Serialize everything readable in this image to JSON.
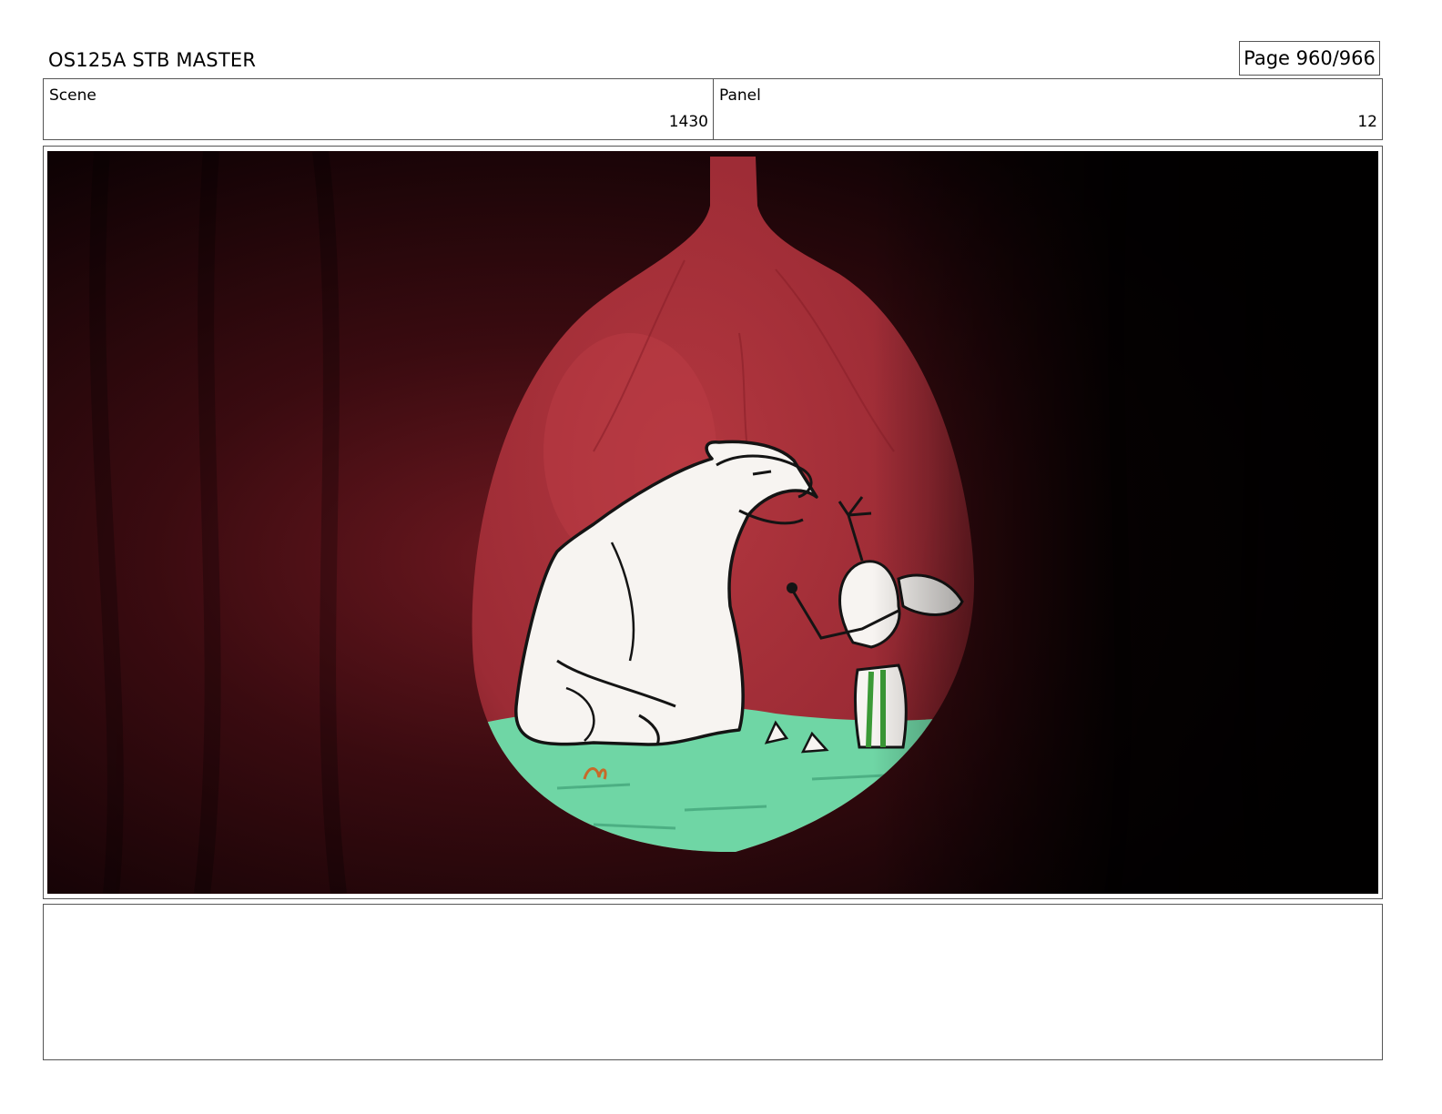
{
  "header": {
    "title": "OS125A STB MASTER",
    "page": "Page 960/966"
  },
  "scene": {
    "label": "Scene",
    "value": "1430"
  },
  "panel": {
    "label": "Panel",
    "value": "12"
  },
  "artwork": {
    "subjects": [
      "polar-bear",
      "deer",
      "green-pool"
    ],
    "colors": {
      "background_dark": "#1a0407",
      "stomach_red": "#a5303a",
      "liquid_green": "#6fd6a5",
      "character_white": "#f7f4f1",
      "stripe_green": "#3b9a36"
    }
  },
  "notes": {
    "text": ""
  }
}
